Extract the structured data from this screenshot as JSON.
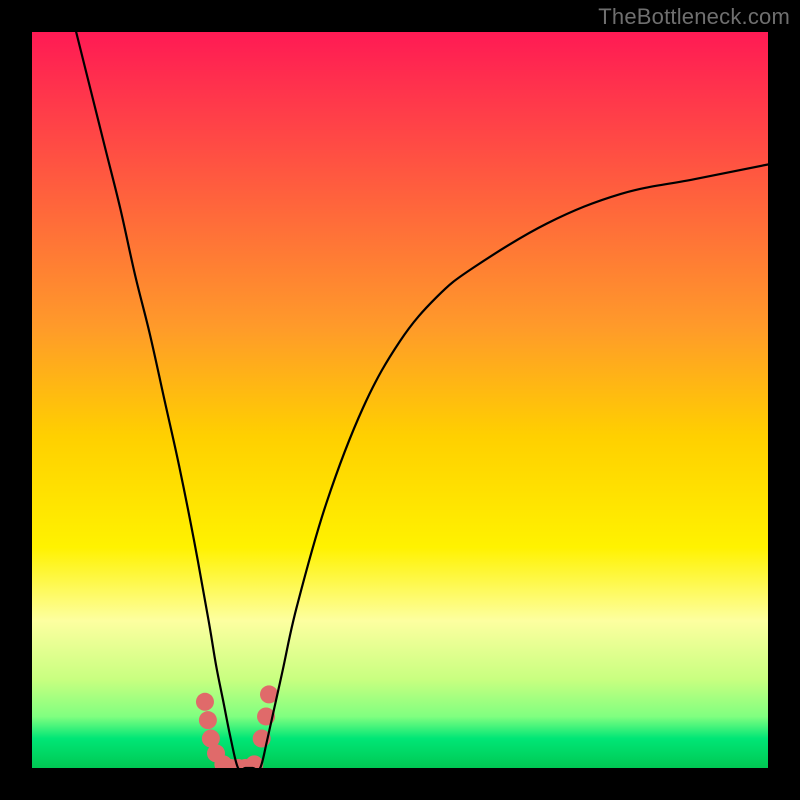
{
  "watermark": {
    "text": "TheBottleneck.com"
  },
  "chart_data": {
    "type": "line",
    "title": "",
    "xlabel": "",
    "ylabel": "",
    "xlim": [
      0,
      100
    ],
    "ylim": [
      0,
      100
    ],
    "background": {
      "gradient": "rainbow-vertical",
      "stops": [
        {
          "pos": 0,
          "color": "#ff1a54"
        },
        {
          "pos": 25,
          "color": "#ff6a3a"
        },
        {
          "pos": 55,
          "color": "#ffd000"
        },
        {
          "pos": 80,
          "color": "#fdffa0"
        },
        {
          "pos": 93,
          "color": "#80ff80"
        },
        {
          "pos": 100,
          "color": "#00c853"
        }
      ]
    },
    "series": [
      {
        "name": "bottleneck-curve",
        "stroke": "#000000",
        "x": [
          6,
          8,
          10,
          12,
          14,
          16,
          18,
          20,
          22,
          24,
          25,
          26,
          27,
          28,
          29,
          30,
          31,
          32,
          34,
          36,
          40,
          45,
          50,
          55,
          60,
          70,
          80,
          90,
          100
        ],
        "y": [
          100,
          92,
          84,
          76,
          67,
          59,
          50,
          41,
          31,
          20,
          14,
          9,
          4,
          0,
          0,
          0,
          0,
          4,
          13,
          22,
          36,
          49,
          58,
          64,
          68,
          74,
          78,
          80,
          82
        ]
      }
    ],
    "markers": [
      {
        "name": "highlight-cluster",
        "color": "#e06a6a",
        "radius": 9,
        "points": [
          {
            "x": 23.5,
            "y": 9
          },
          {
            "x": 23.9,
            "y": 6.5
          },
          {
            "x": 24.3,
            "y": 4
          },
          {
            "x": 25.0,
            "y": 2
          },
          {
            "x": 26.0,
            "y": 0.5
          },
          {
            "x": 27.0,
            "y": 0
          },
          {
            "x": 28.0,
            "y": 0
          },
          {
            "x": 29.0,
            "y": 0
          },
          {
            "x": 30.2,
            "y": 0.5
          },
          {
            "x": 31.2,
            "y": 4
          },
          {
            "x": 31.8,
            "y": 7
          },
          {
            "x": 32.2,
            "y": 10
          }
        ]
      }
    ]
  }
}
